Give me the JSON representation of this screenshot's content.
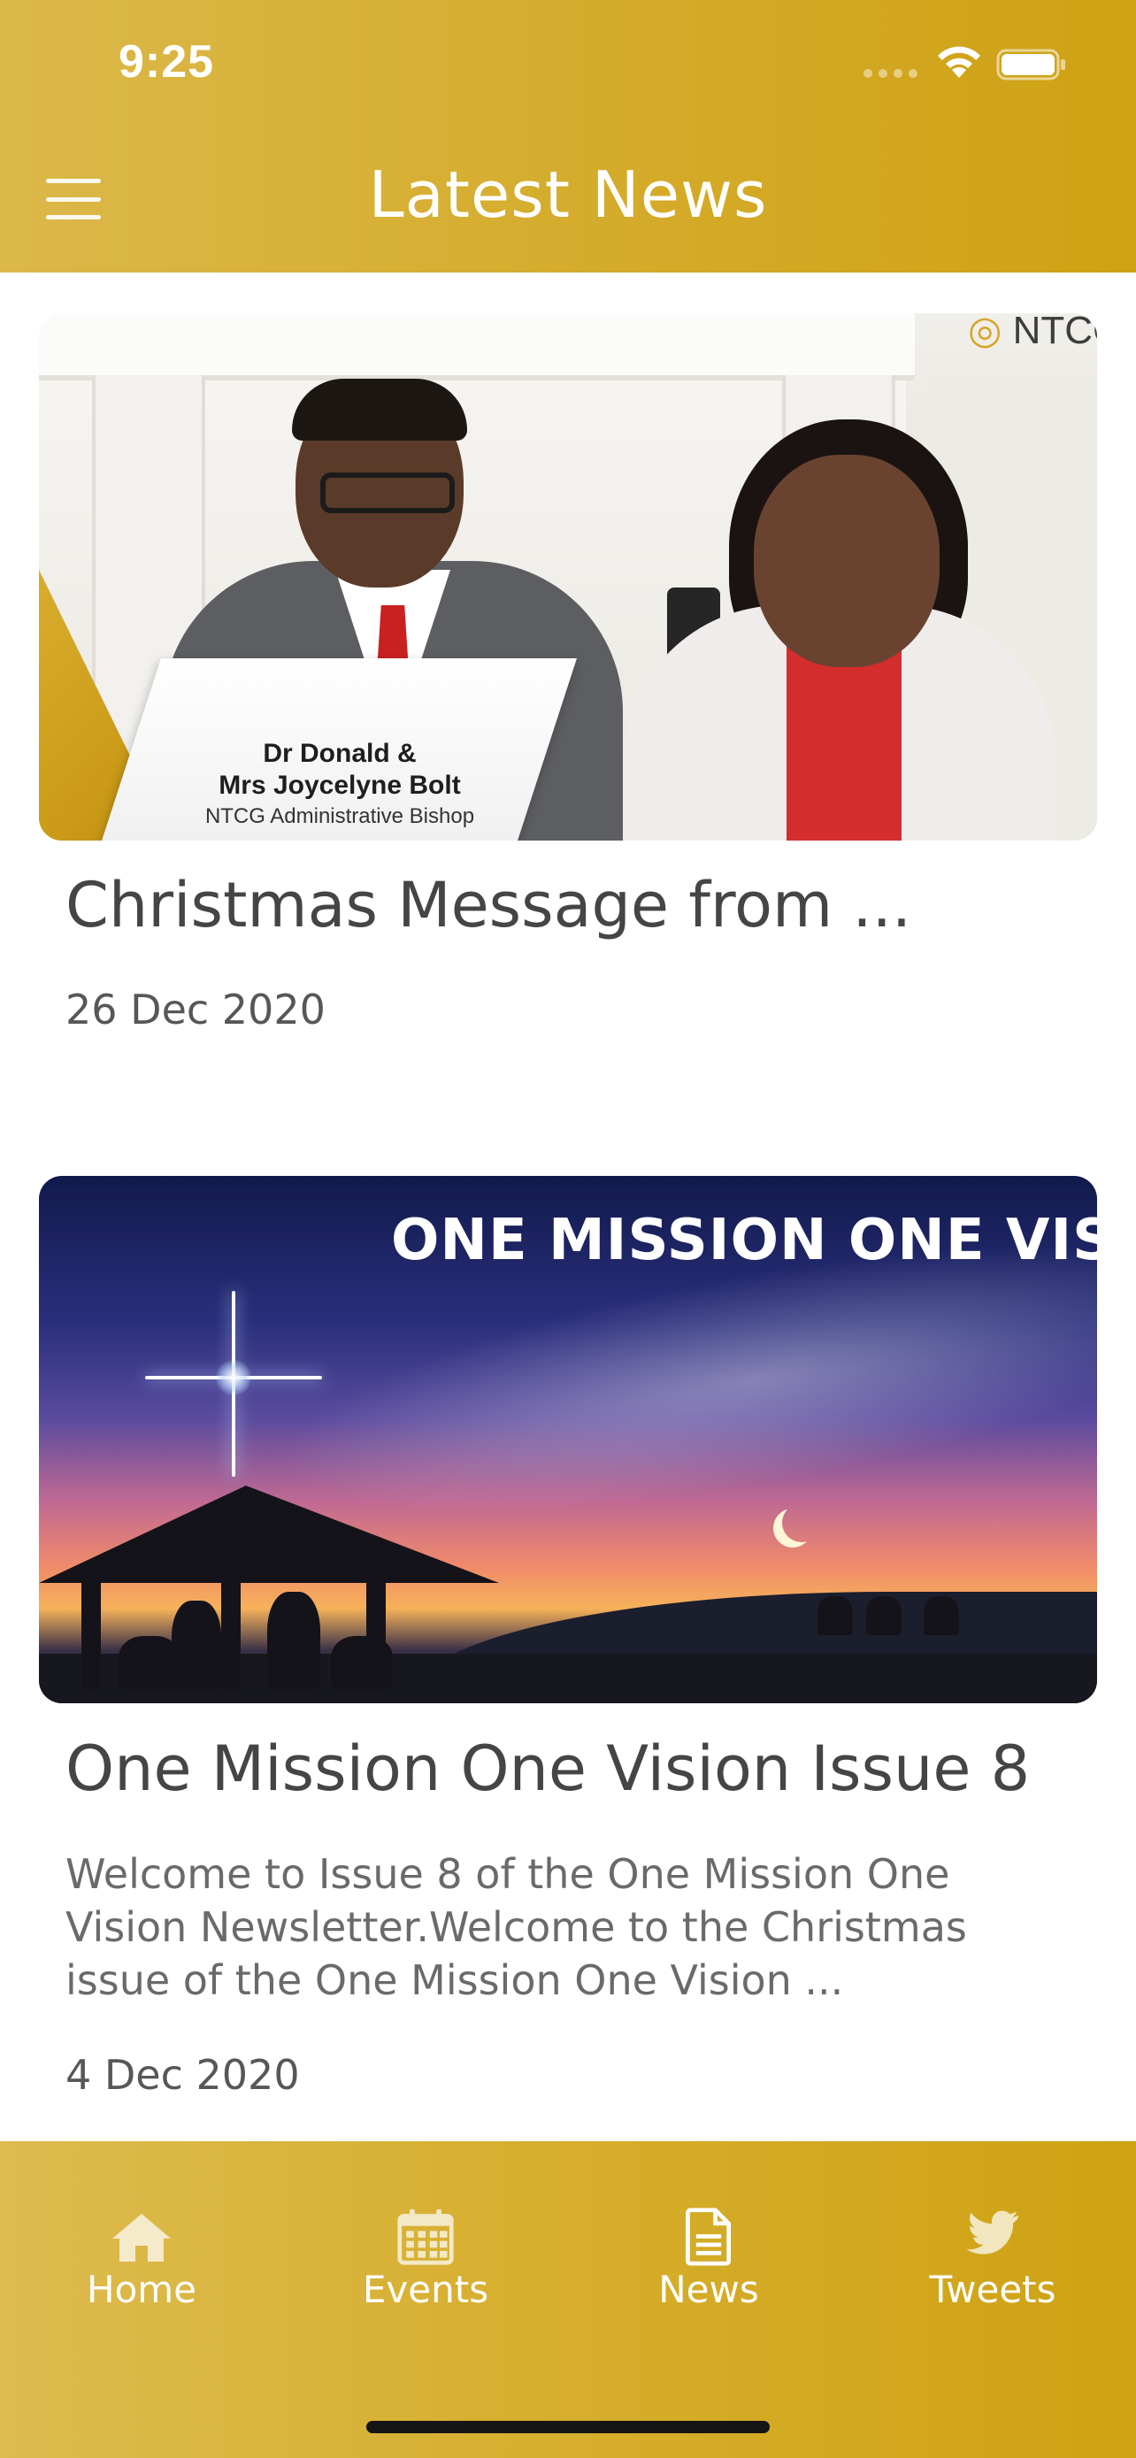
{
  "status_bar": {
    "time": "9:25"
  },
  "header": {
    "title": "Latest News",
    "menu_icon": "hamburger-menu-icon"
  },
  "news": [
    {
      "title": "Christmas Message from ...",
      "date": "26 Dec 2020",
      "image_caption": {
        "line1": "Dr Donald &",
        "line2": "Mrs Joycelyne Bolt",
        "line3": "NTCG Administrative Bishop",
        "logo": "NTCG"
      }
    },
    {
      "title": "One Mission One Vision Issue 8",
      "excerpt": "Welcome to Issue 8 of the One Mission One Vision Newsletter.Welcome to the Christmas issue of the One Mission One Vision ...",
      "date": "4 Dec 2020",
      "image_banner": "ONE MISSION ONE VIS"
    }
  ],
  "tabs": [
    {
      "label": "Home",
      "icon": "home-icon",
      "active": false
    },
    {
      "label": "Events",
      "icon": "calendar-icon",
      "active": false
    },
    {
      "label": "News",
      "icon": "document-icon",
      "active": true
    },
    {
      "label": "Tweets",
      "icon": "twitter-bird-icon",
      "active": false
    }
  ],
  "colors": {
    "brand_gold": "#d4ab2a",
    "text_dark": "#454545",
    "text_muted": "#6a6a6a"
  }
}
